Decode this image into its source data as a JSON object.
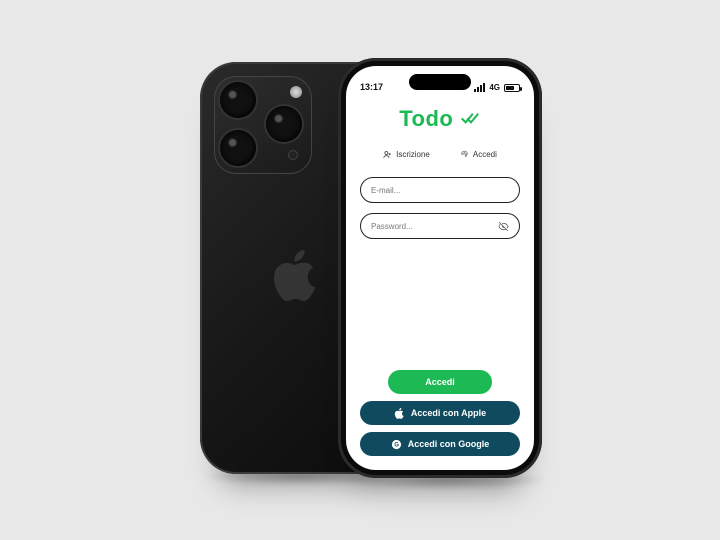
{
  "statusbar": {
    "time": "13:17",
    "network": "4G"
  },
  "app": {
    "brand": "Todo",
    "tabs": {
      "signup_label": "Iscrizione",
      "signin_label": "Accedi"
    },
    "fields": {
      "email_placeholder": "E-mail...",
      "password_placeholder": "Password..."
    },
    "buttons": {
      "primary": "Accedi",
      "apple": "Accedi con Apple",
      "google": "Accedi con Google"
    }
  },
  "colors": {
    "accent": "#1db954",
    "social_button": "#0f4a5f"
  }
}
